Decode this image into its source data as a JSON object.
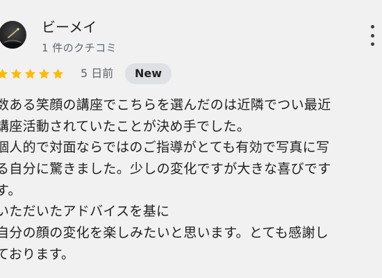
{
  "review": {
    "reviewer_name": "ビーメイ",
    "review_count": "1 件のクチコミ",
    "rating": 5,
    "rating_max": 5,
    "date": "5 日前",
    "badge": "New",
    "lines": [
      "数ある笑顔の講座でこちらを選んだのは近隣でつい最近",
      "講座活動されていたことが決め手でした。",
      "個人的で対面ならではのご指導がとても有効で写真に写",
      "る自分に驚きました。少しの変化ですが大きな喜びです",
      "す。",
      "いただいたアドバイスを基に",
      "自分の顔の変化を楽しみたいと思います。とても感謝し",
      "ております。"
    ]
  },
  "icons": {
    "star": "star-icon",
    "more": "more-vert-icon",
    "avatar": "avatar-image"
  },
  "colors": {
    "star": "#fbbc04",
    "background": "#f1f1f2",
    "badge_bg": "#dfe0e3",
    "secondary_text": "#5f6368"
  }
}
